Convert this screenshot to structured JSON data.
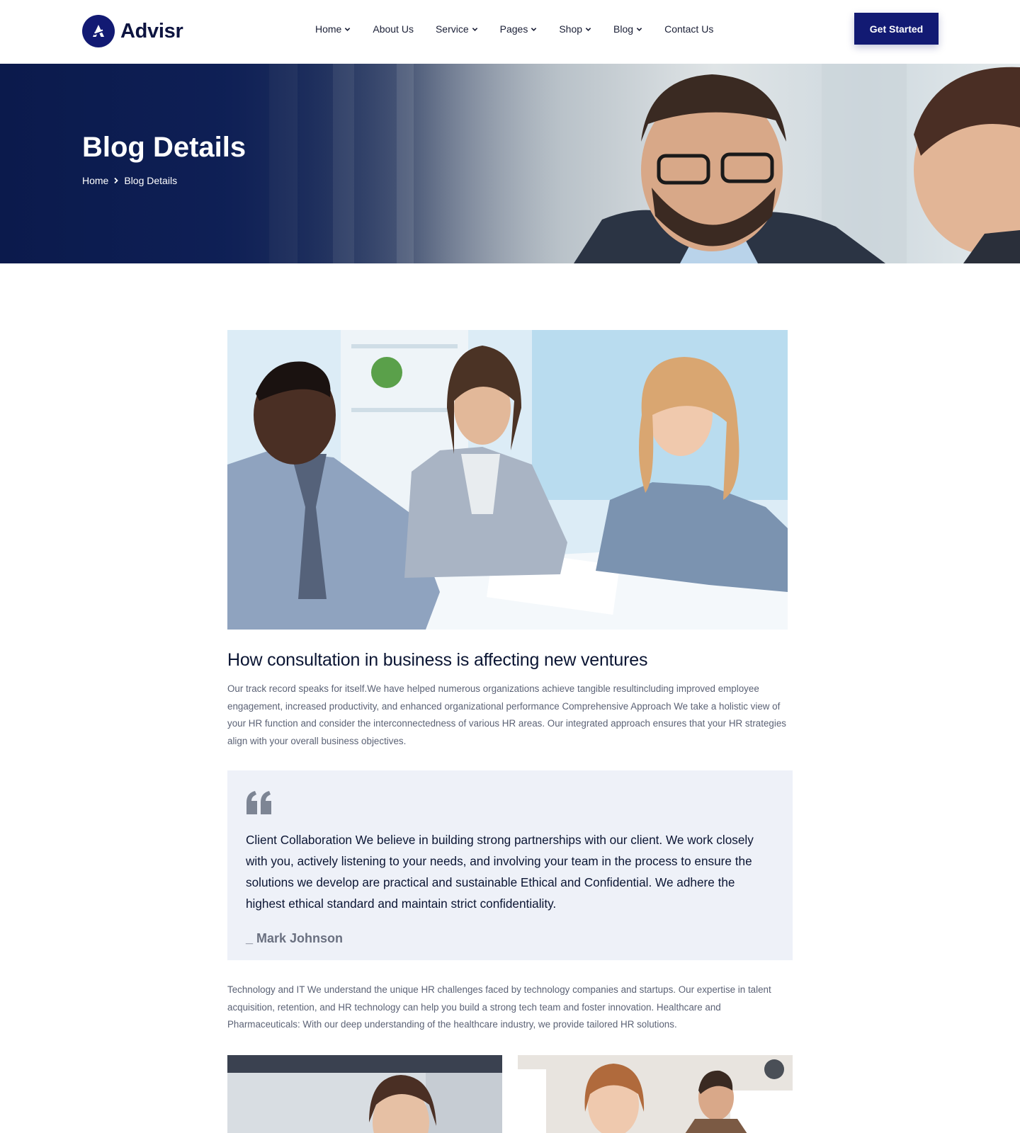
{
  "brand": {
    "name": "Advisr",
    "accent": "#121a73"
  },
  "nav": {
    "items": [
      {
        "label": "Home",
        "dropdown": true
      },
      {
        "label": "About Us",
        "dropdown": false
      },
      {
        "label": "Service",
        "dropdown": true
      },
      {
        "label": "Pages",
        "dropdown": true
      },
      {
        "label": "Shop",
        "dropdown": true
      },
      {
        "label": "Blog",
        "dropdown": true
      },
      {
        "label": "Contact Us",
        "dropdown": false
      }
    ],
    "cta_label": "Get Started"
  },
  "hero": {
    "title": "Blog Details",
    "breadcrumb": [
      "Home",
      "Blog Details"
    ]
  },
  "article": {
    "title": "How consultation in business is affecting new ventures",
    "intro": "Our track record speaks for itself.We have helped numerous organizations achieve tangible resultincluding improved employee engagement, increased productivity, and enhanced organizational performance Comprehensive Approach We take a holistic view of your HR function and consider the interconnectedness of various HR areas. Our integrated approach ensures that your HR strategies align with your overall business objectives.",
    "quote": {
      "text": "Client Collaboration We believe in building strong partnerships with our client. We work closely with you, actively listening to your needs, and involving your team in the process to ensure the solutions we develop are practical and sustainable Ethical and Confidential. We adhere the highest ethical standard and maintain strict confidentiality.",
      "author": "_ Mark Johnson"
    },
    "body": "Technology and IT We understand the unique HR challenges faced by technology companies and startups. Our expertise in talent acquisition, retention, and HR technology can help you build a strong tech team and foster innovation. Healthcare and Pharmaceuticals: With our deep understanding of the healthcare industry, we provide tailored HR solutions."
  }
}
